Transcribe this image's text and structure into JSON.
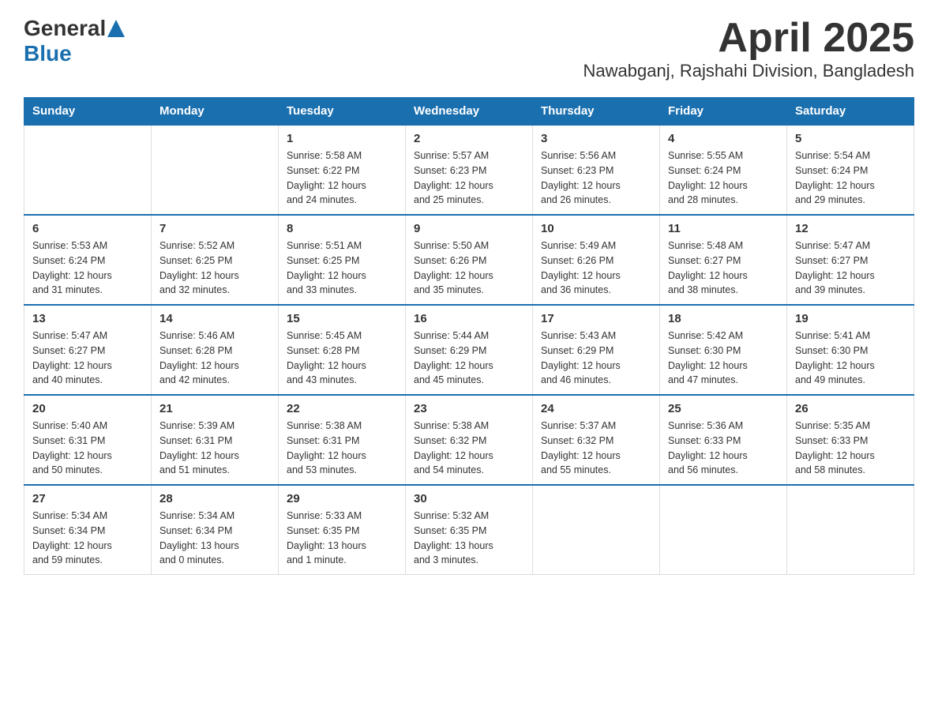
{
  "header": {
    "logo_general": "General",
    "logo_blue": "Blue",
    "title": "April 2025",
    "subtitle": "Nawabganj, Rajshahi Division, Bangladesh"
  },
  "days_of_week": [
    "Sunday",
    "Monday",
    "Tuesday",
    "Wednesday",
    "Thursday",
    "Friday",
    "Saturday"
  ],
  "weeks": [
    [
      {
        "day": "",
        "info": ""
      },
      {
        "day": "",
        "info": ""
      },
      {
        "day": "1",
        "info": "Sunrise: 5:58 AM\nSunset: 6:22 PM\nDaylight: 12 hours\nand 24 minutes."
      },
      {
        "day": "2",
        "info": "Sunrise: 5:57 AM\nSunset: 6:23 PM\nDaylight: 12 hours\nand 25 minutes."
      },
      {
        "day": "3",
        "info": "Sunrise: 5:56 AM\nSunset: 6:23 PM\nDaylight: 12 hours\nand 26 minutes."
      },
      {
        "day": "4",
        "info": "Sunrise: 5:55 AM\nSunset: 6:24 PM\nDaylight: 12 hours\nand 28 minutes."
      },
      {
        "day": "5",
        "info": "Sunrise: 5:54 AM\nSunset: 6:24 PM\nDaylight: 12 hours\nand 29 minutes."
      }
    ],
    [
      {
        "day": "6",
        "info": "Sunrise: 5:53 AM\nSunset: 6:24 PM\nDaylight: 12 hours\nand 31 minutes."
      },
      {
        "day": "7",
        "info": "Sunrise: 5:52 AM\nSunset: 6:25 PM\nDaylight: 12 hours\nand 32 minutes."
      },
      {
        "day": "8",
        "info": "Sunrise: 5:51 AM\nSunset: 6:25 PM\nDaylight: 12 hours\nand 33 minutes."
      },
      {
        "day": "9",
        "info": "Sunrise: 5:50 AM\nSunset: 6:26 PM\nDaylight: 12 hours\nand 35 minutes."
      },
      {
        "day": "10",
        "info": "Sunrise: 5:49 AM\nSunset: 6:26 PM\nDaylight: 12 hours\nand 36 minutes."
      },
      {
        "day": "11",
        "info": "Sunrise: 5:48 AM\nSunset: 6:27 PM\nDaylight: 12 hours\nand 38 minutes."
      },
      {
        "day": "12",
        "info": "Sunrise: 5:47 AM\nSunset: 6:27 PM\nDaylight: 12 hours\nand 39 minutes."
      }
    ],
    [
      {
        "day": "13",
        "info": "Sunrise: 5:47 AM\nSunset: 6:27 PM\nDaylight: 12 hours\nand 40 minutes."
      },
      {
        "day": "14",
        "info": "Sunrise: 5:46 AM\nSunset: 6:28 PM\nDaylight: 12 hours\nand 42 minutes."
      },
      {
        "day": "15",
        "info": "Sunrise: 5:45 AM\nSunset: 6:28 PM\nDaylight: 12 hours\nand 43 minutes."
      },
      {
        "day": "16",
        "info": "Sunrise: 5:44 AM\nSunset: 6:29 PM\nDaylight: 12 hours\nand 45 minutes."
      },
      {
        "day": "17",
        "info": "Sunrise: 5:43 AM\nSunset: 6:29 PM\nDaylight: 12 hours\nand 46 minutes."
      },
      {
        "day": "18",
        "info": "Sunrise: 5:42 AM\nSunset: 6:30 PM\nDaylight: 12 hours\nand 47 minutes."
      },
      {
        "day": "19",
        "info": "Sunrise: 5:41 AM\nSunset: 6:30 PM\nDaylight: 12 hours\nand 49 minutes."
      }
    ],
    [
      {
        "day": "20",
        "info": "Sunrise: 5:40 AM\nSunset: 6:31 PM\nDaylight: 12 hours\nand 50 minutes."
      },
      {
        "day": "21",
        "info": "Sunrise: 5:39 AM\nSunset: 6:31 PM\nDaylight: 12 hours\nand 51 minutes."
      },
      {
        "day": "22",
        "info": "Sunrise: 5:38 AM\nSunset: 6:31 PM\nDaylight: 12 hours\nand 53 minutes."
      },
      {
        "day": "23",
        "info": "Sunrise: 5:38 AM\nSunset: 6:32 PM\nDaylight: 12 hours\nand 54 minutes."
      },
      {
        "day": "24",
        "info": "Sunrise: 5:37 AM\nSunset: 6:32 PM\nDaylight: 12 hours\nand 55 minutes."
      },
      {
        "day": "25",
        "info": "Sunrise: 5:36 AM\nSunset: 6:33 PM\nDaylight: 12 hours\nand 56 minutes."
      },
      {
        "day": "26",
        "info": "Sunrise: 5:35 AM\nSunset: 6:33 PM\nDaylight: 12 hours\nand 58 minutes."
      }
    ],
    [
      {
        "day": "27",
        "info": "Sunrise: 5:34 AM\nSunset: 6:34 PM\nDaylight: 12 hours\nand 59 minutes."
      },
      {
        "day": "28",
        "info": "Sunrise: 5:34 AM\nSunset: 6:34 PM\nDaylight: 13 hours\nand 0 minutes."
      },
      {
        "day": "29",
        "info": "Sunrise: 5:33 AM\nSunset: 6:35 PM\nDaylight: 13 hours\nand 1 minute."
      },
      {
        "day": "30",
        "info": "Sunrise: 5:32 AM\nSunset: 6:35 PM\nDaylight: 13 hours\nand 3 minutes."
      },
      {
        "day": "",
        "info": ""
      },
      {
        "day": "",
        "info": ""
      },
      {
        "day": "",
        "info": ""
      }
    ]
  ]
}
